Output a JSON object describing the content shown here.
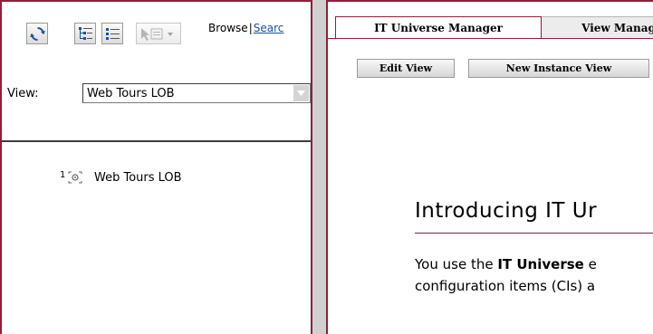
{
  "left_pane": {
    "toolbar": {
      "icons": [
        "refresh-icon",
        "tree-view-icon",
        "list-view-icon",
        "action-dropdown-icon"
      ],
      "browse_label": "Browse",
      "separator": "|",
      "search_label": "Searc"
    },
    "view_label": "View:",
    "view_select_value": "Web Tours LOB",
    "tree": [
      {
        "badge": "1",
        "label": "Web Tours LOB"
      }
    ]
  },
  "right_pane": {
    "tabs": [
      {
        "label": "IT Universe Manager",
        "active": true
      },
      {
        "label": "View Manag",
        "active": false
      }
    ],
    "buttons": {
      "edit_view": "Edit View",
      "new_instance_view": "New Instance View"
    },
    "intro_title": "Introducing IT Ur",
    "intro_p1": {
      "before": "You use the ",
      "bold": "IT Universe",
      "after": " e"
    },
    "intro_p2": "configuration items (CIs) a"
  },
  "colors": {
    "accent": "#8e1f3b",
    "link": "#1a4fa0",
    "background": "#d0d0d0"
  }
}
